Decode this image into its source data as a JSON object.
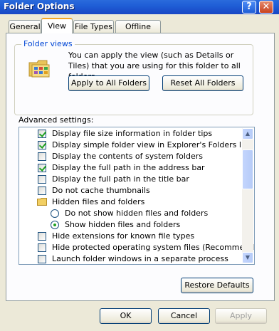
{
  "window": {
    "title": "Folder Options",
    "help_label": "?",
    "close_label": "✕"
  },
  "tabs": [
    {
      "label": "General",
      "active": false
    },
    {
      "label": "View",
      "active": true
    },
    {
      "label": "File Types",
      "active": false
    },
    {
      "label": "Offline Files",
      "active": false
    }
  ],
  "folder_views": {
    "legend": "Folder views",
    "description": "You can apply the view (such as Details or Tiles) that you are using for this folder to all folders.",
    "apply_label": "Apply to All Folders",
    "reset_label": "Reset All Folders",
    "icon": "folder-views-icon"
  },
  "advanced": {
    "label": "Advanced settings:",
    "items": [
      {
        "type": "checkbox",
        "checked": true,
        "label": "Display file size information in folder tips"
      },
      {
        "type": "checkbox",
        "checked": true,
        "label": "Display simple folder view in Explorer's Folders list"
      },
      {
        "type": "checkbox",
        "checked": false,
        "label": "Display the contents of system folders"
      },
      {
        "type": "checkbox",
        "checked": true,
        "label": "Display the full path in the address bar"
      },
      {
        "type": "checkbox",
        "checked": false,
        "label": "Display the full path in the title bar"
      },
      {
        "type": "checkbox",
        "checked": false,
        "label": "Do not cache thumbnails"
      },
      {
        "type": "folder",
        "label": "Hidden files and folders"
      },
      {
        "type": "radio",
        "checked": false,
        "label": "Do not show hidden files and folders"
      },
      {
        "type": "radio",
        "checked": true,
        "label": "Show hidden files and folders"
      },
      {
        "type": "checkbox",
        "checked": false,
        "label": "Hide extensions for known file types"
      },
      {
        "type": "checkbox",
        "checked": false,
        "label": "Hide protected operating system files (Recommended)"
      },
      {
        "type": "checkbox",
        "checked": false,
        "label": "Launch folder windows in a separate process"
      }
    ],
    "restore_label": "Restore Defaults"
  },
  "footer": {
    "ok_label": "OK",
    "cancel_label": "Cancel",
    "apply_label": "Apply"
  },
  "colors": {
    "titlebar": "#1f5ed6",
    "legend": "#0046d5",
    "check": "#21a121"
  }
}
